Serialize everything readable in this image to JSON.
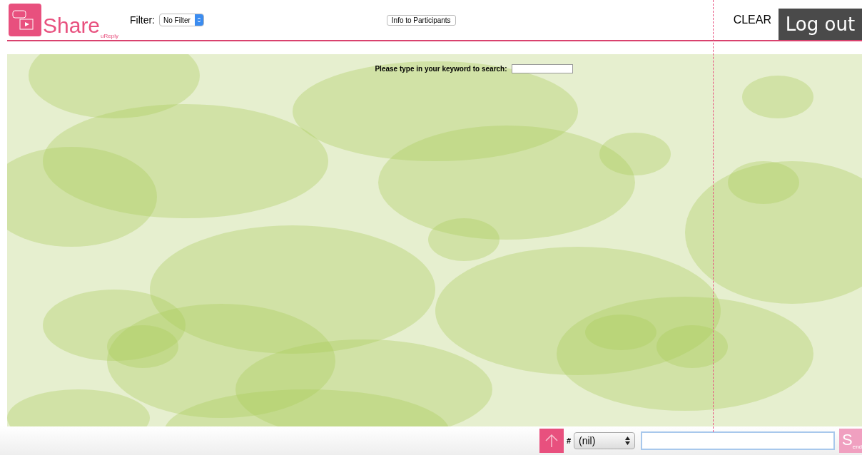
{
  "header": {
    "logo_text": "Share",
    "logo_subtext": "uReply",
    "filter_label": "Filter:",
    "filter_value": "No Filter",
    "info_button": "Info to Participants",
    "clear": "CLEAR",
    "logout": "Log out"
  },
  "search": {
    "label": "Please type in your keyword to search:"
  },
  "composer": {
    "hash": "#",
    "tag_value": "(nil)",
    "send": "S$_{end}$"
  }
}
